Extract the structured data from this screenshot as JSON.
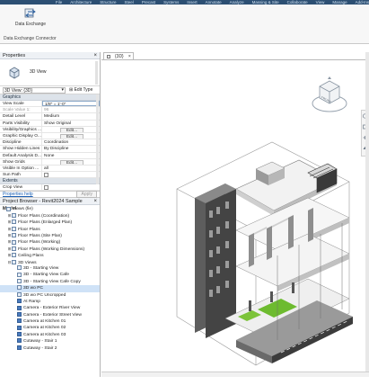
{
  "ribbon": {
    "menu": [
      "File",
      "Architecture",
      "Structure",
      "Steel",
      "Precast",
      "Systems",
      "Insert",
      "Annotate",
      "Analyze",
      "Massing & Site",
      "Collaborate",
      "View",
      "Manage",
      "Add-Ins",
      "Modify"
    ],
    "button_label": "Data Exchange",
    "panel_label": "Data Exchange Connector"
  },
  "properties": {
    "title": "Properties",
    "type_name": "3D View",
    "instance_select": "3D View: {3D}",
    "edit_type_label": "Edit Type",
    "groups": {
      "graphics": "Graphics",
      "extents": "Extents"
    },
    "rows": [
      {
        "k": "View Scale",
        "v": "1/8\" = 1'-0\""
      },
      {
        "k": "Scale Value    1:",
        "v": "96"
      },
      {
        "k": "Detail Level",
        "v": "Medium"
      },
      {
        "k": "Parts Visibility",
        "v": "Show Original"
      },
      {
        "k": "Visibility/Graphics ...",
        "v": "Edit..."
      },
      {
        "k": "Graphic Display O...",
        "v": "Edit..."
      },
      {
        "k": "Discipline",
        "v": "Coordination"
      },
      {
        "k": "Show Hidden Lines",
        "v": "By Discipline"
      },
      {
        "k": "Default Analysis D...",
        "v": "None"
      },
      {
        "k": "Show Grids",
        "v": "Edit..."
      },
      {
        "k": "Visible In Option ...",
        "v": "all"
      },
      {
        "k": "Sun Path",
        "v": ""
      }
    ],
    "extent_rows": [
      {
        "k": "Crop View",
        "v": ""
      }
    ],
    "help_link": "Properties help",
    "apply_label": "Apply"
  },
  "browser": {
    "title": "Project Browser - Revit2024 Sample Model...",
    "items": [
      {
        "label": "Views (fie)",
        "indent": 0,
        "ex": "⊟"
      },
      {
        "label": "Floor Plans (Coordination)",
        "indent": 1,
        "ex": "⊞"
      },
      {
        "label": "Floor Plans (Enlarged Plan)",
        "indent": 1,
        "ex": "⊞"
      },
      {
        "label": "Floor Plans",
        "indent": 1,
        "ex": "⊞"
      },
      {
        "label": "Floor Plans (Site Plan)",
        "indent": 1,
        "ex": "⊞"
      },
      {
        "label": "Floor Plans (Working)",
        "indent": 1,
        "ex": "⊞"
      },
      {
        "label": "Floor Plans (Working Dimensions)",
        "indent": 1,
        "ex": "⊞"
      },
      {
        "label": "Ceiling Plans",
        "indent": 1,
        "ex": "⊞"
      },
      {
        "label": "3D Views",
        "indent": 1,
        "ex": "⊟"
      },
      {
        "label": "3D - Starting View",
        "indent": 2,
        "ex": ""
      },
      {
        "label": "3D - Starting View Cafe",
        "indent": 2,
        "ex": ""
      },
      {
        "label": "3D - Starting View Cafe Copy",
        "indent": 2,
        "ex": ""
      },
      {
        "label": "3D wo PC",
        "indent": 2,
        "ex": "",
        "sel": true
      },
      {
        "label": "3D wo PC Uncropped",
        "indent": 2,
        "ex": ""
      },
      {
        "label": "At Ramp",
        "indent": 2,
        "ex": "",
        "cam": true
      },
      {
        "label": "Camera - Exterior River View",
        "indent": 2,
        "ex": "",
        "cam": true
      },
      {
        "label": "Camera - Exterior Street View",
        "indent": 2,
        "ex": "",
        "cam": true
      },
      {
        "label": "Camera at Kitchen 01",
        "indent": 2,
        "ex": "",
        "cam": true
      },
      {
        "label": "Camera at Kitchen 02",
        "indent": 2,
        "ex": "",
        "cam": true
      },
      {
        "label": "Camera at Kitchen 03",
        "indent": 2,
        "ex": "",
        "cam": true
      },
      {
        "label": "Cutaway - Stair 1",
        "indent": 2,
        "ex": "",
        "cam": true
      },
      {
        "label": "Cutaway - Stair 2",
        "indent": 2,
        "ex": "",
        "cam": true
      }
    ]
  },
  "view": {
    "tab_label": "{3D}",
    "viewcube_face": "FRONT"
  }
}
